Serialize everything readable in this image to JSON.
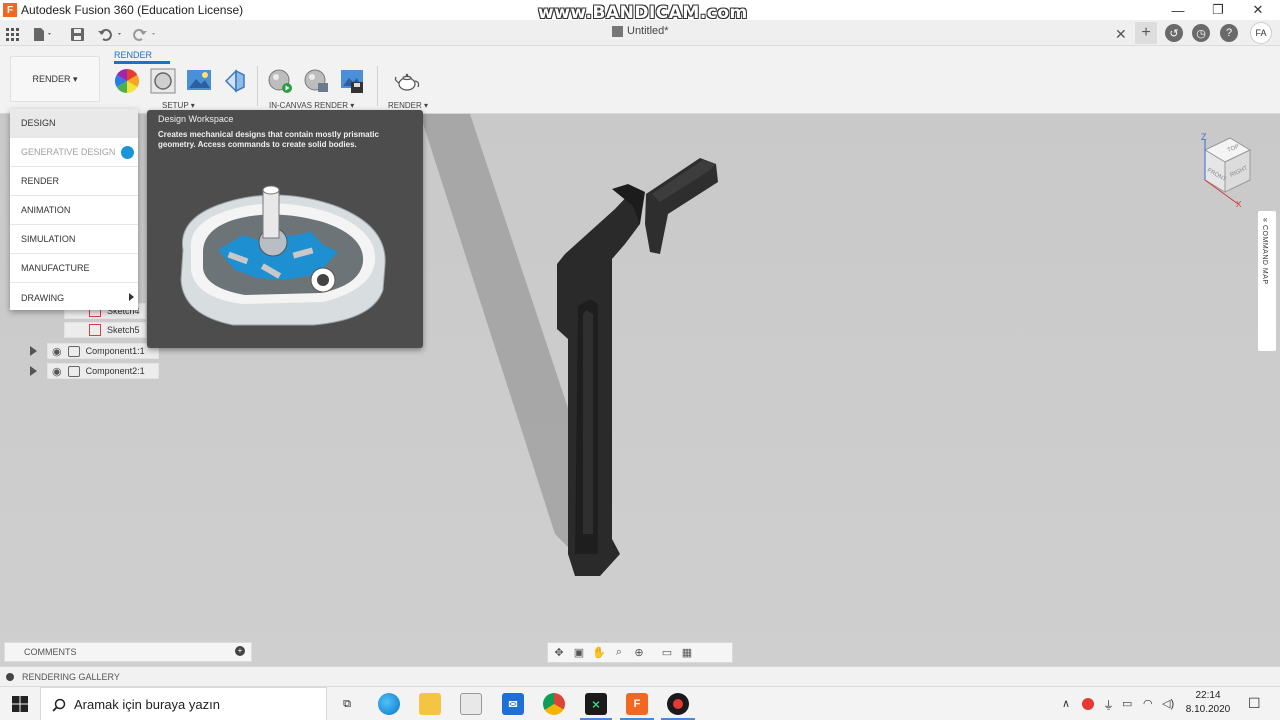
{
  "window": {
    "app_icon_letter": "F",
    "title": "Autodesk Fusion 360 (Education License)",
    "watermark": "www.BANDICAM.com"
  },
  "document": {
    "tab_title": "Untitled*"
  },
  "user": {
    "initials": "FA"
  },
  "toolbar": {
    "workspace_button": "RENDER ▾",
    "active_tab": "RENDER",
    "groups": {
      "setup": "SETUP ▾",
      "in_canvas": "IN-CANVAS RENDER ▾",
      "render": "RENDER ▾"
    }
  },
  "workspace_menu": {
    "items": [
      {
        "label": "DESIGN"
      },
      {
        "label": "GENERATIVE DESIGN"
      },
      {
        "label": "RENDER"
      },
      {
        "label": "ANIMATION"
      },
      {
        "label": "SIMULATION"
      },
      {
        "label": "MANUFACTURE"
      },
      {
        "label": "DRAWING"
      }
    ]
  },
  "tooltip": {
    "title": "Design Workspace",
    "description": "Creates mechanical designs that contain mostly prismatic geometry. Access commands to create solid bodies."
  },
  "browser": {
    "sketch_items": [
      "Sketch4",
      "Sketch5"
    ],
    "components": [
      "Component1:1",
      "Component2:1"
    ]
  },
  "viewcube": {
    "faces": [
      "TOP",
      "FRONT",
      "RIGHT"
    ],
    "axis_z": "Z",
    "axis_x": "X"
  },
  "command_map": {
    "label": "COMMAND MAP"
  },
  "panels": {
    "comments": "COMMENTS",
    "rendering_gallery": "RENDERING GALLERY"
  },
  "taskbar": {
    "search_placeholder": "Aramak için buraya yazın",
    "time": "22:14",
    "date": "8.10.2020"
  },
  "colors": {
    "accent": "#1a73c8",
    "fusion_orange": "#f26722",
    "model": "#2a2a2a",
    "tooltip_bg": "#4d4d4d"
  }
}
